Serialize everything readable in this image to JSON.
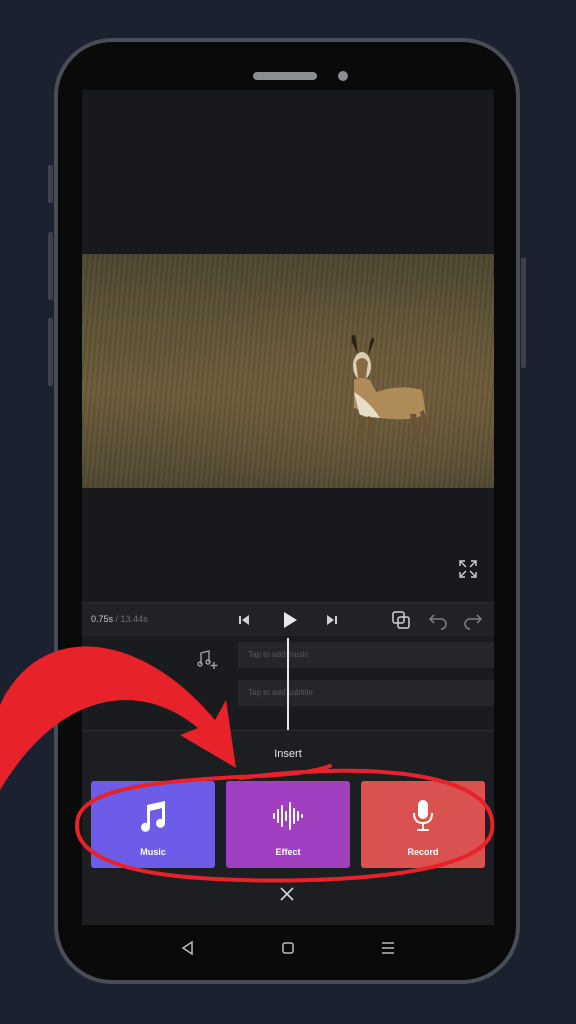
{
  "player": {
    "current_time": "0.75s",
    "total_time": "/ 13.44s"
  },
  "timeline": {
    "music_track_placeholder": "Tap to add music",
    "subtitle_track_placeholder": "Tap to add subtitle"
  },
  "insert_panel": {
    "title": "Insert",
    "options": [
      {
        "label": "Music",
        "icon": "music-note-icon",
        "color": "#6c5ce7"
      },
      {
        "label": "Effect",
        "icon": "sound-wave-icon",
        "color": "#a040c0"
      },
      {
        "label": "Record",
        "icon": "microphone-icon",
        "color": "#d9524f"
      }
    ]
  },
  "annotation_color": "#e8222a"
}
